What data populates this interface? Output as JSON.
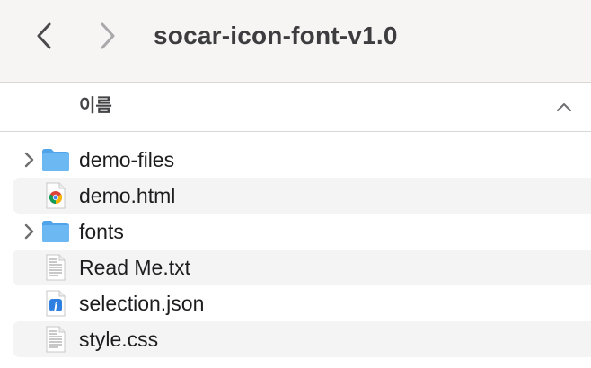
{
  "window": {
    "title": "socar-icon-font-v1.0"
  },
  "toolbar": {
    "back_icon": "chevron-left-icon",
    "forward_icon": "chevron-right-icon"
  },
  "columns": {
    "name_label": "이름",
    "sort_icon": "chevron-up-icon"
  },
  "files": [
    {
      "name": "demo-files",
      "kind": "folder",
      "icon": "folder-icon",
      "expandable": true
    },
    {
      "name": "demo.html",
      "kind": "html",
      "icon": "chrome-document-icon",
      "expandable": false
    },
    {
      "name": "fonts",
      "kind": "folder",
      "icon": "folder-icon",
      "expandable": true
    },
    {
      "name": "Read Me.txt",
      "kind": "text",
      "icon": "text-document-icon",
      "expandable": false
    },
    {
      "name": "selection.json",
      "kind": "json",
      "icon": "json-document-icon",
      "expandable": false
    },
    {
      "name": "style.css",
      "kind": "text",
      "icon": "text-document-icon",
      "expandable": false
    }
  ],
  "colors": {
    "folder": "#5aaef0",
    "folder_tab": "#7cc0f5",
    "row_alt": "#f4f4f4",
    "toolbar_bg": "#f6f5f4"
  }
}
